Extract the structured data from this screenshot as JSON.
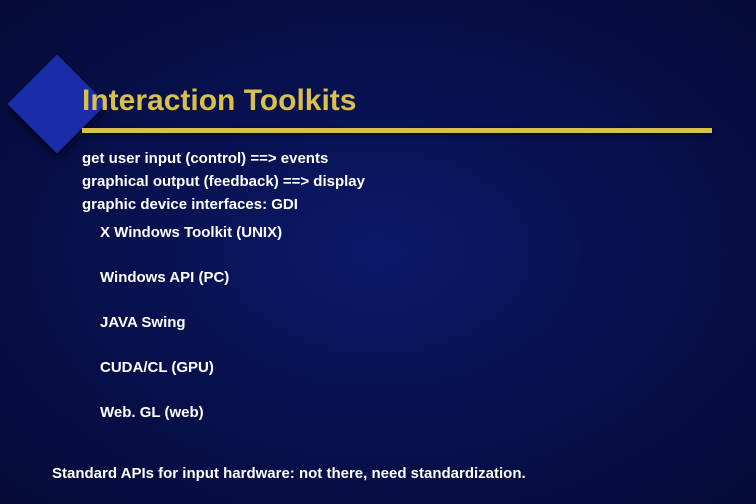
{
  "title": "Interaction Toolkits",
  "intro": {
    "line1": "get user input (control) ==> events",
    "line2": "graphical output (feedback) ==> display",
    "line3": "graphic device interfaces: GDI"
  },
  "items": {
    "i1": "X Windows Toolkit (UNIX)",
    "i2": "Windows API (PC)",
    "i3": "JAVA Swing",
    "i4": "CUDA/CL (GPU)",
    "i5": "Web. GL (web)"
  },
  "footer": "Standard APIs for input hardware:  not there, need standardization."
}
